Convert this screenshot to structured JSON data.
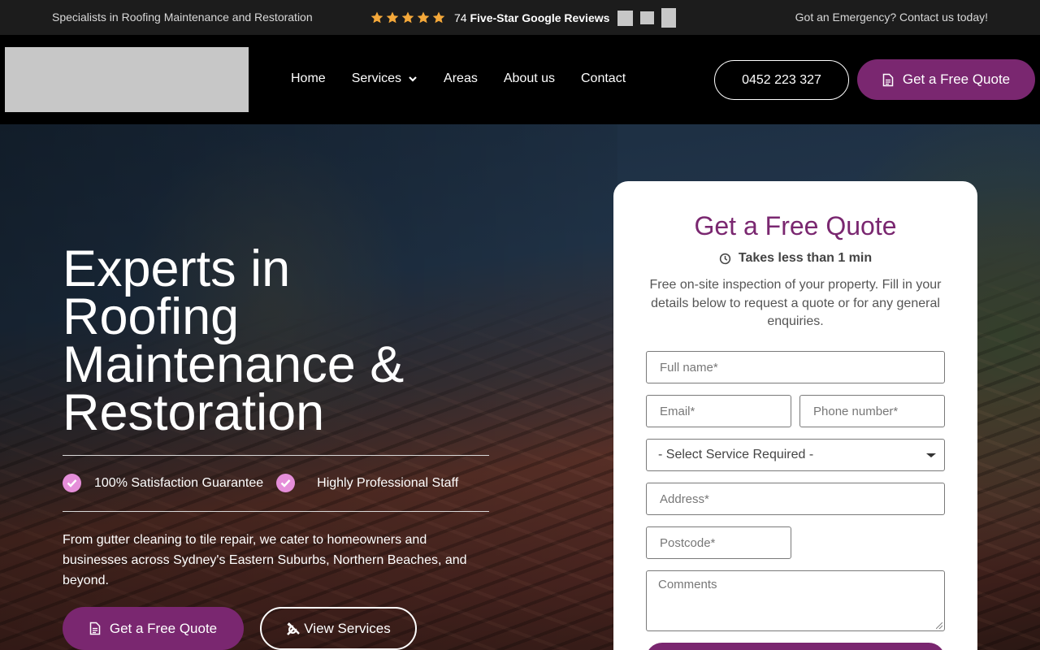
{
  "topbar": {
    "tagline": "Specialists in Roofing Maintenance and Restoration",
    "reviews_count": "74",
    "reviews_label": "Five-Star Google Reviews",
    "stars": 5,
    "emergency": "Got an Emergency? Contact us today!"
  },
  "header": {
    "nav": {
      "home": "Home",
      "services": "Services",
      "areas": "Areas",
      "about": "About us",
      "contact": "Contact"
    },
    "phone": "0452 223 327",
    "quote_label": "Get a Free Quote"
  },
  "hero": {
    "title_lines": [
      "Experts in",
      "Roofing",
      "Maintenance &",
      "Restoration"
    ],
    "badge1": "100% Satisfaction Guarantee",
    "badge2": "Highly Professional Staff",
    "intro": "From gutter cleaning to tile repair, we cater to homeowners and businesses across Sydney's Eastern Suburbs, Northern Beaches, and beyond.",
    "cta_quote": "Get a Free Quote",
    "cta_services": "View Services"
  },
  "form": {
    "title": "Get a Free Quote",
    "time_note": "Takes less than 1 min",
    "description": "Free on-site inspection of your property. Fill in your details below to request a quote or for any general enquiries.",
    "full_name_placeholder": "Full name*",
    "email_placeholder": "Email*",
    "phone_placeholder": "Phone number*",
    "service_selected": "- Select Service Required -",
    "address_placeholder": "Address*",
    "postcode_placeholder": "Postcode*",
    "comments_placeholder": "Comments"
  },
  "colors": {
    "brand": "#7a2770",
    "accent_pink": "#e58ed9",
    "star": "#f4a83a"
  },
  "icons": {
    "stars": "star-icon",
    "services_chevron": "chevron-down-icon",
    "quote": "document-icon",
    "clock": "clock-icon",
    "badges": "check-circle-icon",
    "services": "tools-icon"
  }
}
